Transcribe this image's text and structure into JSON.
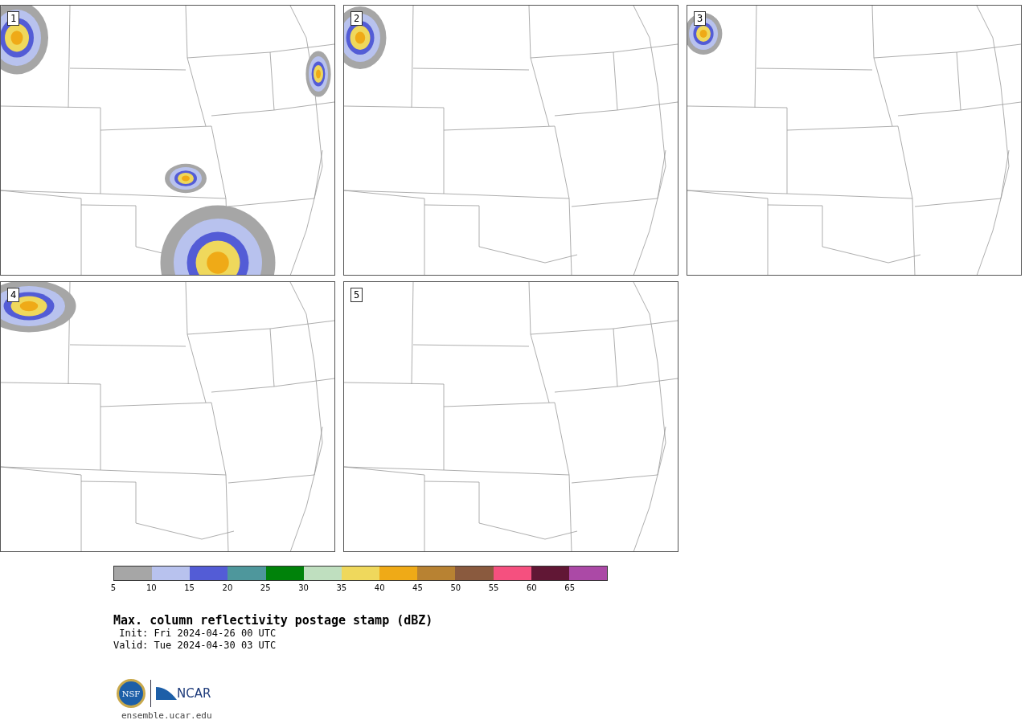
{
  "panels": [
    {
      "label": "1"
    },
    {
      "label": "2"
    },
    {
      "label": "3"
    },
    {
      "label": "4"
    },
    {
      "label": "5"
    }
  ],
  "colorbar": {
    "segments": [
      {
        "color": "#a6a6a6"
      },
      {
        "color": "#b8c2ee"
      },
      {
        "color": "#535cd6"
      },
      {
        "color": "#4e979c"
      },
      {
        "color": "#00820a"
      },
      {
        "color": "#bfdfbf"
      },
      {
        "color": "#efd85c"
      },
      {
        "color": "#efaa17"
      },
      {
        "color": "#b88232"
      },
      {
        "color": "#8a5a3e"
      },
      {
        "color": "#f5507f"
      },
      {
        "color": "#611735"
      },
      {
        "color": "#ab49a6"
      }
    ],
    "ticks": [
      "5",
      "10",
      "15",
      "20",
      "25",
      "30",
      "35",
      "40",
      "45",
      "50",
      "55",
      "60",
      "65"
    ]
  },
  "title": "Max. column reflectivity postage stamp (dBZ)",
  "init": " Init: Fri 2024-04-26 00 UTC",
  "valid": "Valid: Tue 2024-04-30 03 UTC",
  "logos": {
    "nsf": "NSF",
    "ncar": "NCAR"
  },
  "url": "ensemble.ucar.edu"
}
